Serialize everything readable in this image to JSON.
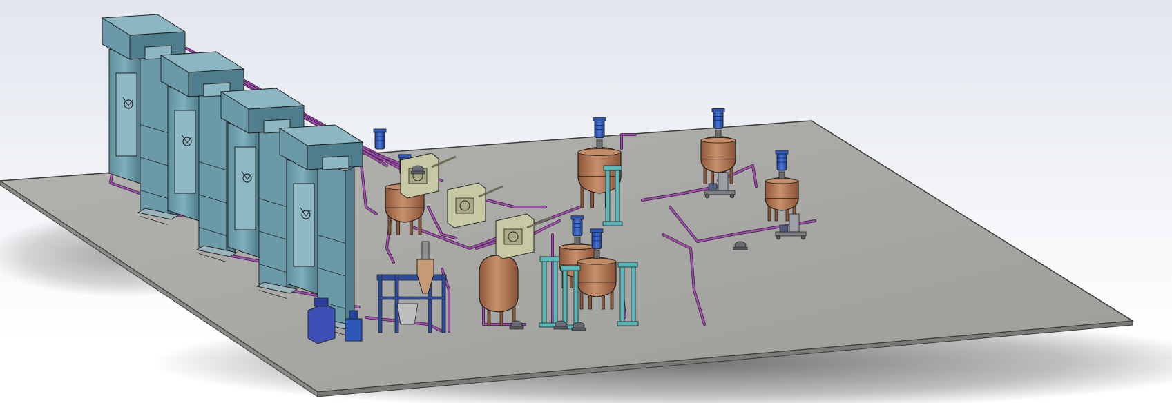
{
  "viewport": {
    "background_top": "#e2e6ee",
    "background_bottom": "#ffffff"
  },
  "colors": {
    "floor": "#a7a7a3",
    "floor_edge": "#3a3a3a",
    "tower": "#6a9aa8",
    "tower_dark": "#4f7d8b",
    "tower_light": "#8bb6c2",
    "pipe": "#a24fb0",
    "vessel": "#b97a5a",
    "vessel_dark": "#8c5538",
    "motor": "#2f57b8",
    "frame_cyan": "#58b7b8",
    "machine": "#c7c9a4",
    "cyclone": "#c59a75",
    "blue_frame": "#2c4a9a",
    "outline": "#222222"
  },
  "equipment": {
    "spray_towers": 4,
    "large_reactors": 4,
    "small_reactors": 2,
    "grinders": 3,
    "dosing_skids": 2,
    "storage_tank": 1,
    "cyclone_station": 1
  }
}
